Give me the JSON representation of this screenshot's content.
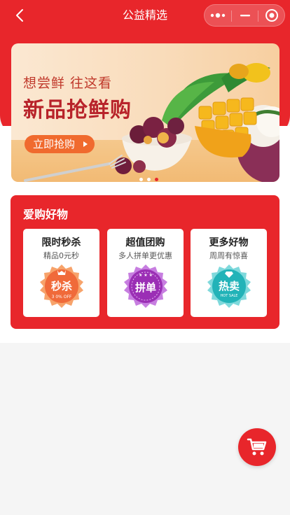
{
  "nav": {
    "title": "公益精选",
    "back_icon": "chevron-left-icon",
    "more_icon": "more-dots-icon",
    "minimize_icon": "minimize-icon",
    "close_icon": "target-circle-icon"
  },
  "banner": {
    "subtitle": "想尝鲜 往这看",
    "headline": "新品抢鲜购",
    "cta_label": "立即抢购",
    "page_indicator": {
      "count": 3,
      "active_index": 2
    }
  },
  "section": {
    "title": "爱购好物",
    "cards": [
      {
        "title": "限时秒杀",
        "subtitle": "精品0元秒",
        "badge_text": "秒杀",
        "badge_small": "3 0% OFF",
        "badge_color": "#f06a3a",
        "badge_icon": "crown-icon"
      },
      {
        "title": "超值团购",
        "subtitle": "多人拼单更优惠",
        "badge_text": "拼单",
        "badge_small": "★ ★ ★",
        "badge_color": "#9b2fb5",
        "badge_icon": "stars-icon"
      },
      {
        "title": "更多好物",
        "subtitle": "周周有惊喜",
        "badge_text": "热卖",
        "badge_small": "HOT SALE",
        "badge_color": "#22b3b8",
        "badge_icon": "diamond-icon"
      }
    ]
  },
  "cart_fab": {
    "icon": "shopping-cart-icon"
  },
  "colors": {
    "primary_red": "#e8262b",
    "cta_orange": "#f06a2e"
  }
}
